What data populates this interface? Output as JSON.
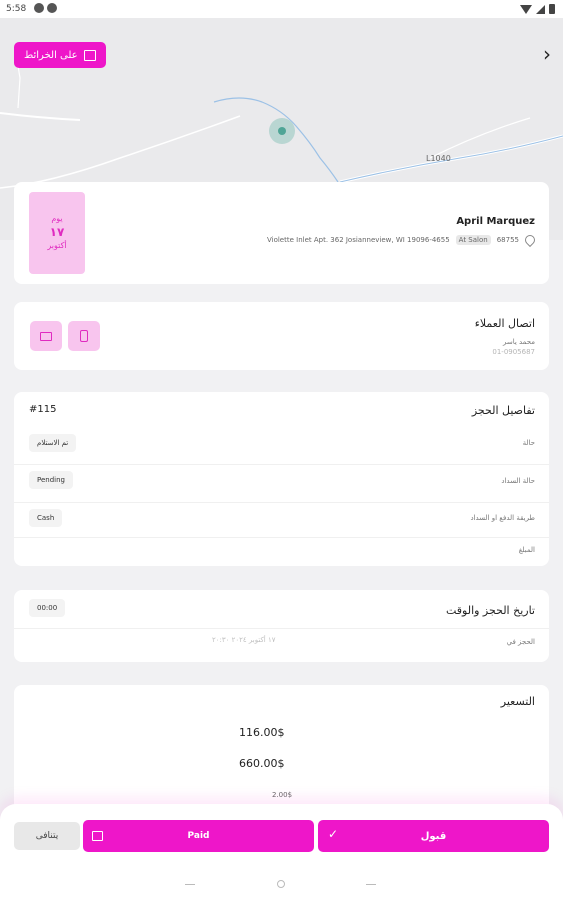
{
  "status_bar": {
    "time": "5:58"
  },
  "map": {
    "show_on_map_label": "على الخرائط",
    "road_label": "L1040"
  },
  "customer": {
    "date_day_label": "يوم",
    "date_day": "١٧",
    "date_month": "أكتوبر",
    "name": "April Marquez",
    "address": "Violette Inlet Apt. 362 Josianneview, WI 19096-4655",
    "salon_badge": "At Salon",
    "postal": "68755"
  },
  "contact": {
    "title": "اتصال العملاء",
    "name": "محمد ياسر",
    "phone": "01-0905687"
  },
  "booking": {
    "title": "تفاصيل الحجز",
    "number": "#115",
    "rows": [
      {
        "label": "حالة",
        "value": "تم الاستلام"
      },
      {
        "label": "حالة السداد",
        "value": "Pending"
      },
      {
        "label": "طريقة الدفع او السداد",
        "value": "Cash"
      },
      {
        "label": "المبلغ",
        "value": ""
      }
    ]
  },
  "schedule": {
    "title": "تاريخ الحجز والوقت",
    "time": "00:00",
    "booked_in_label": "الحجز في",
    "booked_in_value": "١٧ أكتوبر ٢٠٢٤ ٢٠:٣٠"
  },
  "pricing": {
    "title": "التسعير",
    "values": [
      "116.00$",
      "660.00$",
      "2.00$"
    ]
  },
  "actions": {
    "decline": "يتنافى",
    "paid": "Paid",
    "accept": "قبول"
  },
  "colors": {
    "accent": "#ee16c9",
    "accent_light": "#f8c5ee"
  }
}
